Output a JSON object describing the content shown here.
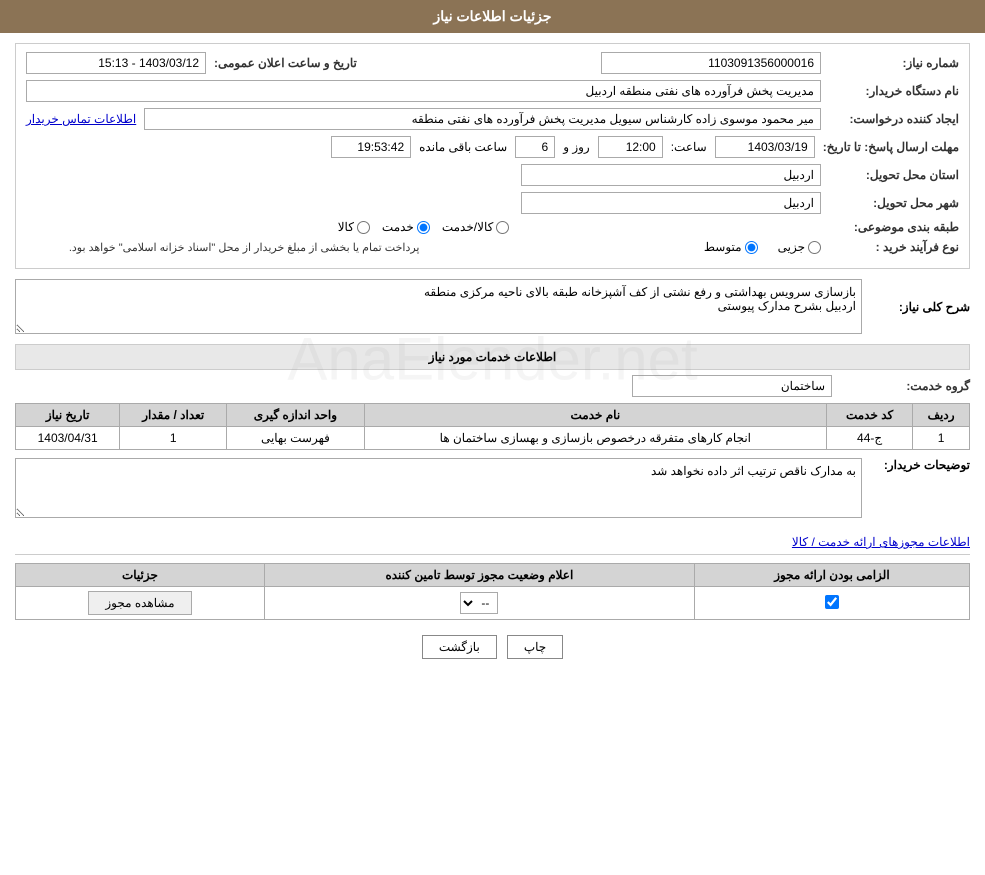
{
  "page": {
    "title": "جزئیات اطلاعات نیاز",
    "header_bg": "#8B7355"
  },
  "fields": {
    "need_number_label": "شماره نیاز:",
    "need_number_value": "1103091356000016",
    "buyer_org_label": "نام دستگاه خریدار:",
    "buyer_org_value": "مدیریت پخش فرآورده های نفتی منطقه اردبیل",
    "requester_label": "ایجاد کننده درخواست:",
    "requester_value": "میر محمود موسوی زاده کارشناس سیویل مدیریت پخش فرآورده های نفتی منطقه",
    "contact_link": "اطلاعات تماس خریدار",
    "deadline_label": "مهلت ارسال پاسخ: تا تاریخ:",
    "deadline_date": "1403/03/19",
    "deadline_time_label": "ساعت:",
    "deadline_time": "12:00",
    "deadline_days_label": "روز و",
    "deadline_days": "6",
    "deadline_remaining_label": "ساعت باقی مانده",
    "deadline_remaining": "19:53:42",
    "announce_datetime_label": "تاریخ و ساعت اعلان عمومی:",
    "announce_datetime_value": "1403/03/12 - 15:13",
    "province_label": "استان محل تحویل:",
    "province_value": "اردبیل",
    "city_label": "شهر محل تحویل:",
    "city_value": "اردبیل",
    "category_label": "طبقه بندی موضوعی:",
    "category_options": [
      "کالا",
      "خدمت",
      "کالا/خدمت"
    ],
    "category_selected": "خدمت",
    "process_label": "نوع فرآیند خرید :",
    "process_options": [
      "جزیی",
      "متوسط"
    ],
    "process_note": "پرداخت تمام یا بخشی از مبلغ خریدار از محل \"اسناد خزانه اسلامی\" خواهد بود.",
    "need_desc_label": "شرح کلی نیاز:",
    "need_desc_value": "بازسازی سرویس بهداشتی و رفع نشتی از کف آشپزخانه طبقه بالای ناحیه مرکزی منطقه اردبیل بشرح مدارک پیوستی",
    "services_title": "اطلاعات خدمات مورد نیاز",
    "service_group_label": "گروه خدمت:",
    "service_group_value": "ساختمان",
    "table": {
      "headers": [
        "ردیف",
        "کد خدمت",
        "نام خدمت",
        "واحد اندازه گیری",
        "تعداد / مقدار",
        "تاریخ نیاز"
      ],
      "rows": [
        {
          "row": "1",
          "code": "ج-44",
          "name": "انجام کارهای متفرقه درخصوص بازسازی و بهسازی ساختمان ها",
          "unit": "فهرست بهایی",
          "qty": "1",
          "date": "1403/04/31"
        }
      ]
    },
    "buyer_notes_label": "توضیحات خریدار:",
    "buyer_notes_value": "به مدارک ناقص ترتیب اثر داده نخواهد شد",
    "permits_section_title": "اطلاعات مجوزهای ارائه خدمت / کالا",
    "permits_table": {
      "headers": [
        "الزامی بودن ارائه مجوز",
        "اعلام وضعیت مجوز توسط تامین کننده",
        "جزئیات"
      ],
      "rows": [
        {
          "required": true,
          "status": "--",
          "details_btn": "مشاهده مجوز"
        }
      ]
    },
    "btn_print": "چاپ",
    "btn_back": "بازگشت"
  }
}
